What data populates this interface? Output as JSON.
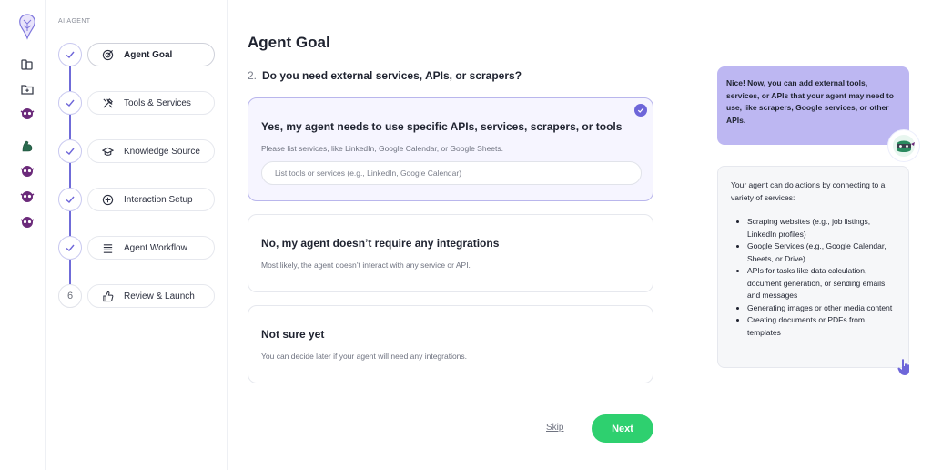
{
  "rail": {
    "icons": [
      "brain-logo-icon",
      "library-icon",
      "folder-plus-icon",
      "agent-mask-icon",
      "muscle-icon",
      "agent-mask-icon",
      "agent-mask-icon",
      "agent-mask-icon"
    ]
  },
  "sidebar": {
    "caption": "AI AGENT",
    "steps": [
      {
        "label": "Agent Goal",
        "status": "active",
        "icon": "target-icon"
      },
      {
        "label": "Tools & Services",
        "status": "done",
        "icon": "tools-icon"
      },
      {
        "label": "Knowledge Source",
        "status": "done",
        "icon": "graduation-cap-icon"
      },
      {
        "label": "Interaction Setup",
        "status": "done",
        "icon": "interaction-icon"
      },
      {
        "label": "Agent Workflow",
        "status": "done",
        "icon": "workflow-icon"
      },
      {
        "label": "Review & Launch",
        "status": "pending",
        "number": "6",
        "icon": "thumbs-up-icon"
      }
    ]
  },
  "main": {
    "title": "Agent Goal",
    "question_number": "2.",
    "question": "Do you need external services, APIs, or scrapers?",
    "options": [
      {
        "title": "Yes, my agent needs to use specific APIs, services, scrapers, or tools",
        "description": "Please list services, like LinkedIn, Google Calendar, or Google Sheets.",
        "input_placeholder": "List tools or services (e.g., LinkedIn, Google Calendar)",
        "selected": true
      },
      {
        "title": "No, my agent doesn’t require any integrations",
        "description": "Most likely, the agent doesn’t interact with any service or API.",
        "selected": false
      },
      {
        "title": "Not sure yet",
        "description": "You can decide later if your agent will need any integrations.",
        "selected": false
      }
    ],
    "skip_label": "Skip",
    "next_label": "Next"
  },
  "assistant": {
    "bubble": "Nice! Now, you can add external tools, services, or APIs that your agent may need to use, like scrapers, Google services, or other APIs.",
    "intro": "Your agent can do actions by connecting to a variety of services:",
    "bullets": [
      "Scraping websites (e.g., job listings, LinkedIn profiles)",
      "Google Services (e.g., Google Calendar, Sheets, or Drive)",
      "APIs for tasks like data calculation, document generation, or sending emails and messages",
      "Generating images or other media content",
      "Creating documents or PDFs from templates"
    ]
  },
  "colors": {
    "accent": "#6e66d9",
    "bubble": "#bdb7f2",
    "next": "#2ed06f",
    "selected_bg": "#f6f5ff",
    "agent_icon": "#6b2a7a"
  }
}
